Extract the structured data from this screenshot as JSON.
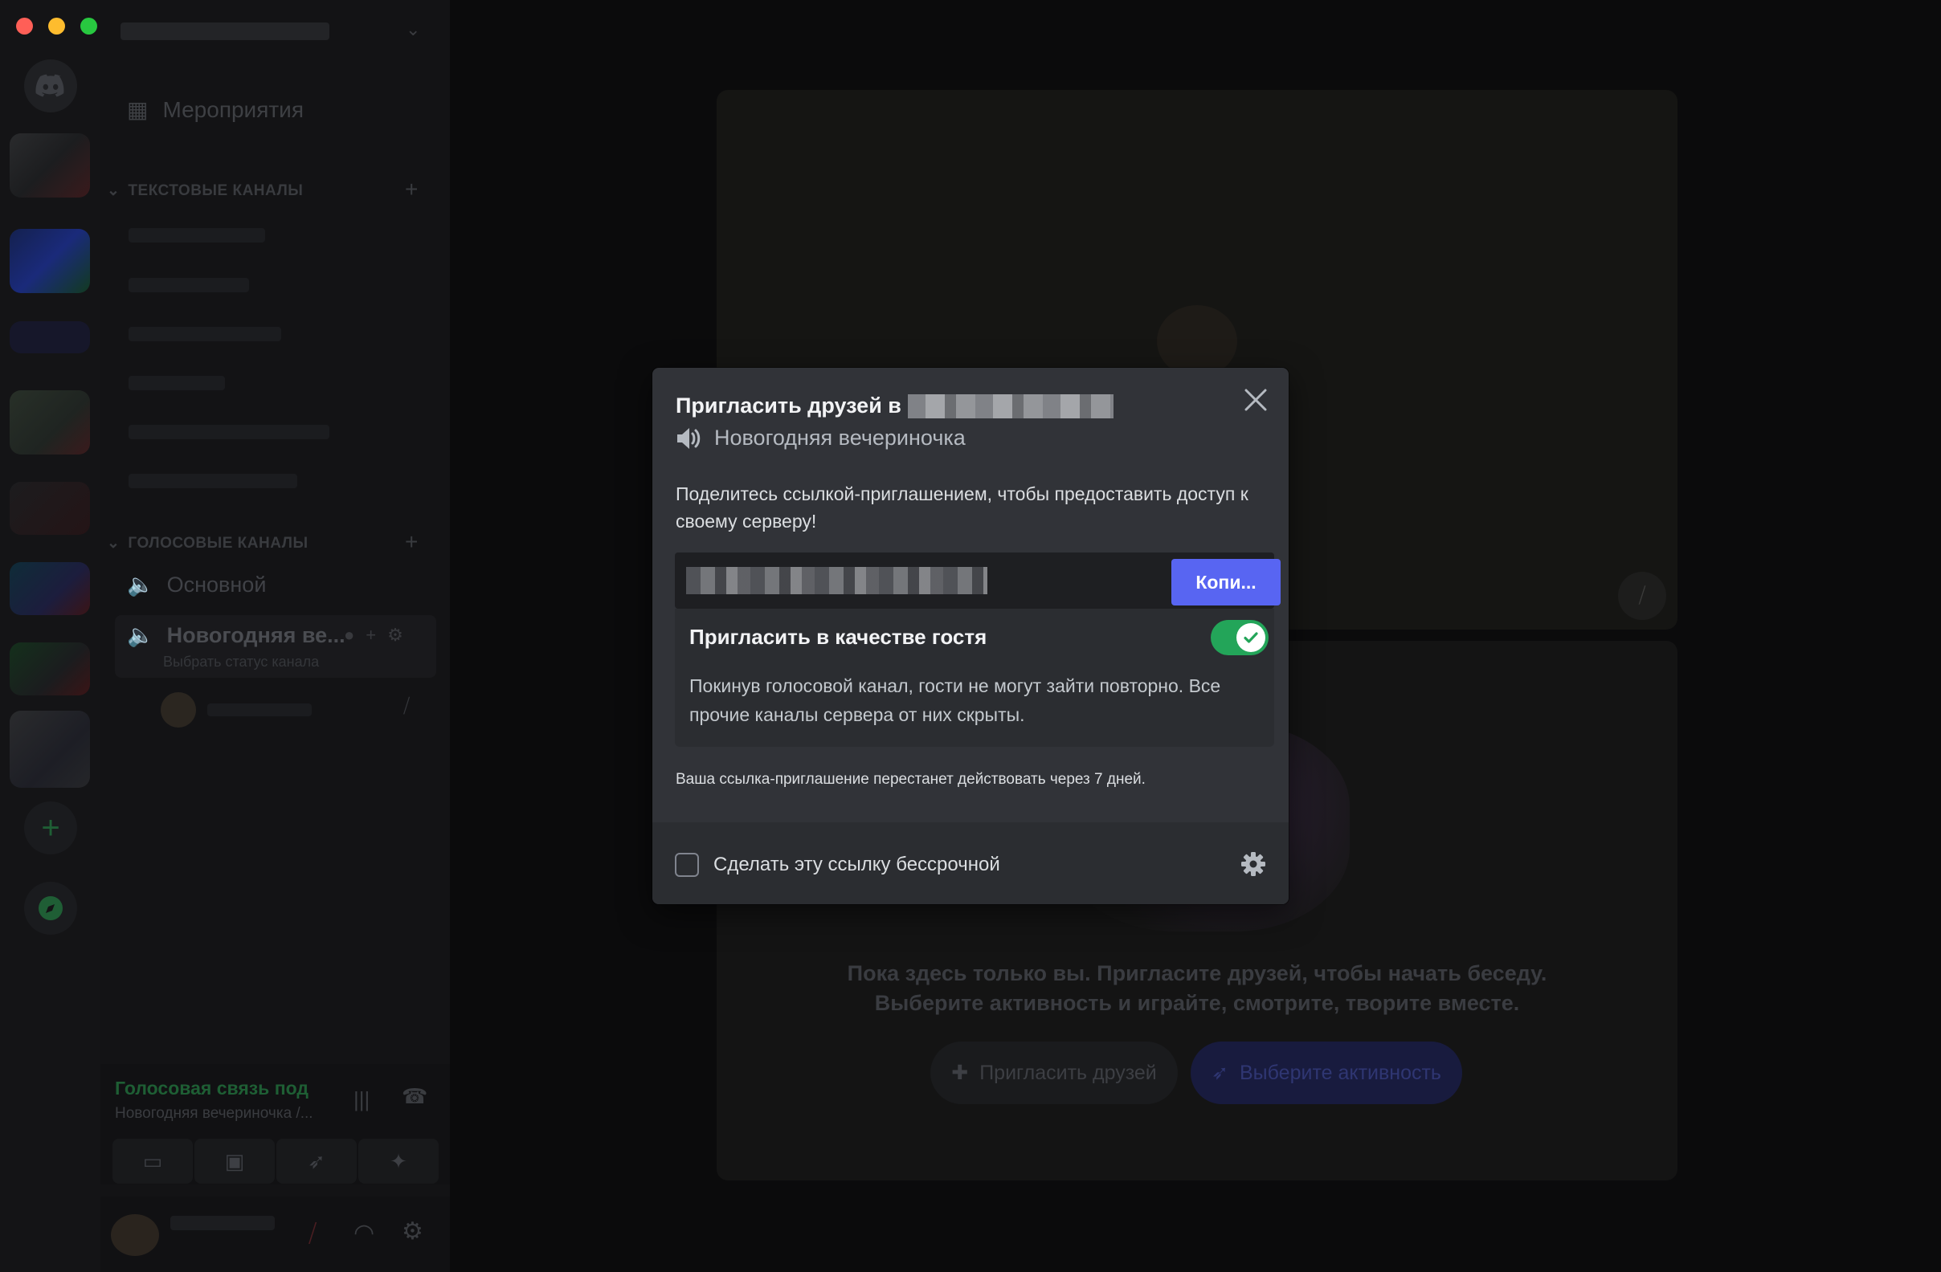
{
  "window": {
    "controls": [
      "close",
      "minimize",
      "maximize"
    ]
  },
  "sidebar": {
    "events_label": "Мероприятия",
    "text_category": "ТЕКСТОВЫЕ КАНАЛЫ",
    "voice_category": "ГОЛОСОВЫЕ КАНАЛЫ",
    "voice_channels": [
      {
        "name": "Основной"
      },
      {
        "name": "Новогодняя ве...",
        "status": "Выбрать статус канала"
      }
    ]
  },
  "voice_panel": {
    "title": "Голосовая связь под",
    "subtitle": "Новогодняя вечериночка /..."
  },
  "stage": {
    "empty_line1": "Пока здесь только вы. Пригласите друзей, чтобы начать беседу.",
    "empty_line2": "Выберите активность и играйте, смотрите, творите вместе.",
    "invite_button": "Пригласить друзей",
    "activity_button": "Выберите активность"
  },
  "modal": {
    "title": "Пригласить друзей в",
    "channel_name": "Новогодняя вечериночка",
    "description": "Поделитесь ссылкой-приглашением, чтобы предоставить доступ к своему серверу!",
    "copy_button": "Копи...",
    "guest_title": "Пригласить в качестве гостя",
    "guest_enabled": true,
    "guest_description": "Покинув голосовой канал, гости не могут зайти повторно. Все прочие каналы сервера от них скрыты.",
    "expire_note": "Ваша ссылка-приглашение перестанет действовать через 7 дней.",
    "permanent_label": "Сделать эту ссылку бессрочной",
    "permanent_checked": false
  },
  "colors": {
    "accent": "#5865f2",
    "toggle_on": "#23a559",
    "modal_bg": "#313338",
    "link_bg": "#1e1f22"
  }
}
